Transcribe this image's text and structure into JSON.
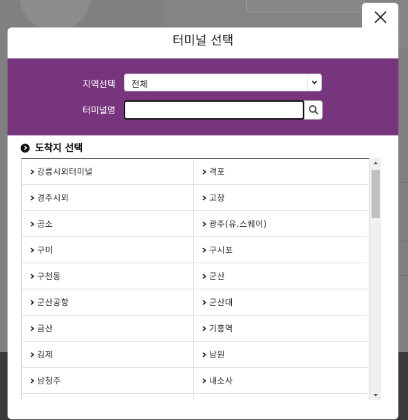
{
  "modal": {
    "title": "터미널 선택",
    "region_label": "지역선택",
    "region_selected": "전체",
    "terminal_label": "터미널명",
    "terminal_value": "",
    "section_title": "도착지 선택"
  },
  "terminals": [
    [
      "강릉시외터미널",
      "격포"
    ],
    [
      "경주시외",
      "고창"
    ],
    [
      "곰소",
      "광주(유.스퀘어)"
    ],
    [
      "구미",
      "구시포"
    ],
    [
      "구천동",
      "군산"
    ],
    [
      "군산공항",
      "군산대"
    ],
    [
      "금산",
      "기흥역"
    ],
    [
      "김제",
      "남원"
    ],
    [
      "남청주",
      "내소사"
    ],
    [
      "",
      ""
    ]
  ],
  "colors": {
    "band": "#76357d"
  },
  "icons": {
    "close": "close-icon",
    "search": "search-icon",
    "dropdown": "chevron-down-icon",
    "item": "chevron-right-icon",
    "section": "circle-chevron-icon"
  }
}
